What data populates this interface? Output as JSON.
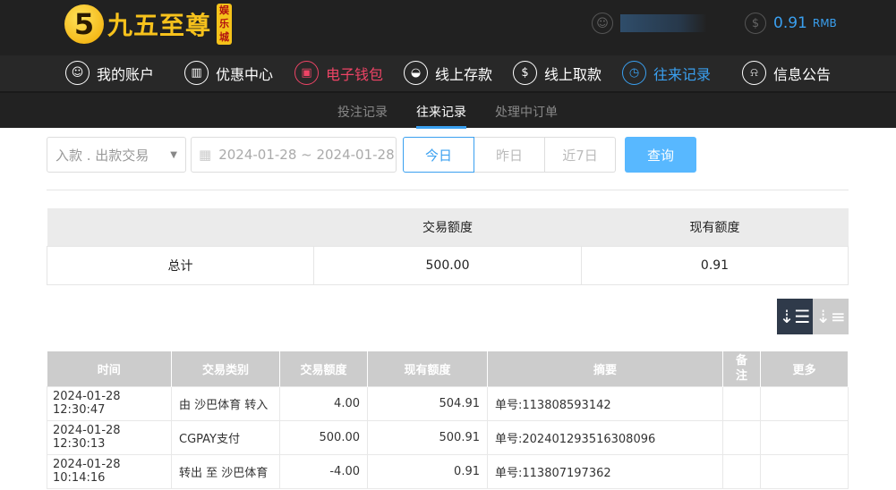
{
  "header": {
    "logo_mark": "5",
    "logo_text": "九五至尊",
    "logo_badge": "娱乐城",
    "balance": "0.91",
    "currency": "RMB"
  },
  "nav": [
    {
      "label": "我的账户",
      "icon": "user-icon"
    },
    {
      "label": "优惠中心",
      "icon": "gift-icon"
    },
    {
      "label": "电子钱包",
      "icon": "wallet-icon"
    },
    {
      "label": "线上存款",
      "icon": "deposit-icon"
    },
    {
      "label": "线上取款",
      "icon": "withdraw-icon"
    },
    {
      "label": "往来记录",
      "icon": "records-icon"
    },
    {
      "label": "信息公告",
      "icon": "bell-icon"
    }
  ],
  "subtabs": [
    "投注记录",
    "往来记录",
    "处理中订单"
  ],
  "filter": {
    "type": "入款 . 出款交易",
    "date_range": "2024-01-28 ~ 2024-01-28",
    "today": "今日",
    "yesterday": "昨日",
    "last7": "近7日",
    "query": "查询"
  },
  "summary": {
    "headers": [
      "",
      "交易额度",
      "现有额度"
    ],
    "row": [
      "总计",
      "500.00",
      "0.91"
    ]
  },
  "table": {
    "headers": [
      "时间",
      "交易类别",
      "交易额度",
      "现有额度",
      "摘要",
      "备注",
      "更多"
    ],
    "rows": [
      [
        "2024-01-28 12:30:47",
        "由 沙巴体育 转入",
        "4.00",
        "504.91",
        "单号:113808593142",
        "",
        ""
      ],
      [
        "2024-01-28 12:30:13",
        "CGPAY支付",
        "500.00",
        "500.91",
        "单号:202401293516308096",
        "",
        ""
      ],
      [
        "2024-01-28 10:14:16",
        "转出 至 沙巴体育",
        "-4.00",
        "0.91",
        "单号:113807197362",
        "",
        ""
      ]
    ]
  },
  "colors": {
    "accent": "#3aa0f0",
    "wallet": "#ee4466",
    "header_bg": "#212121"
  }
}
